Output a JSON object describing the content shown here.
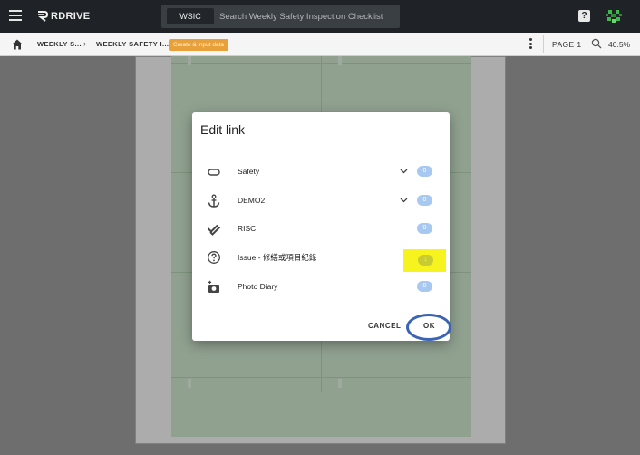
{
  "app": {
    "logo_text": "RDRIVE",
    "search_chip": "WSIC",
    "search_placeholder": "Search Weekly Safety Inspection Checklist",
    "help_glyph": "?"
  },
  "toolbar": {
    "breadcrumb_1": "WEEKLY S...",
    "breadcrumb_sep": "›",
    "breadcrumb_2": "WEEKLY SAFETY I...",
    "badge": "Create & input data",
    "page_label": "PAGE 1",
    "zoom_value": "40.5%"
  },
  "dialog": {
    "title": "Edit link",
    "rows": [
      {
        "icon": "link-icon",
        "label": "Safety",
        "has_chevron": true,
        "count": "0"
      },
      {
        "icon": "anchor-icon",
        "label": "DEMO2",
        "has_chevron": true,
        "count": "0"
      },
      {
        "icon": "double-check-icon",
        "label": "RISC",
        "has_chevron": false,
        "count": "0"
      },
      {
        "icon": "help-circle-icon",
        "label": "Issue - 修繕或項目紀錄",
        "has_chevron": false,
        "count": "1",
        "highlighted": true
      },
      {
        "icon": "add-photo-icon",
        "label": "Photo Diary",
        "has_chevron": false,
        "count": "0"
      }
    ],
    "cancel_label": "CANCEL",
    "ok_label": "OK"
  },
  "colors": {
    "topbar": "#1f2327",
    "accent_badge": "#e8a13a",
    "toggle": "#a7c8f0",
    "highlight": "#f7f31e",
    "ok_ring": "#3c64b4",
    "sheet": "#cfe7cf"
  }
}
